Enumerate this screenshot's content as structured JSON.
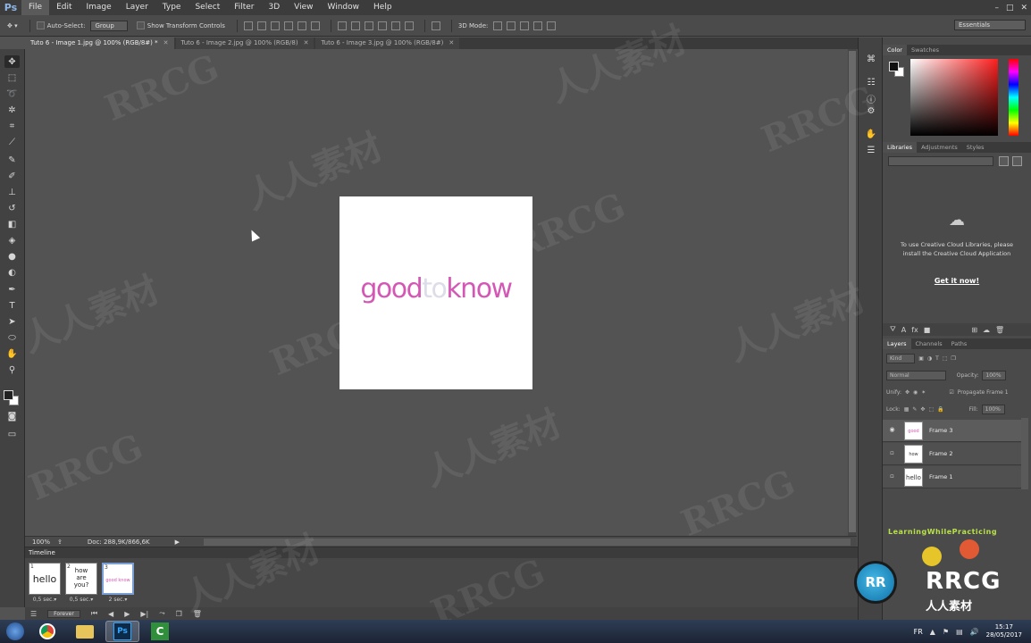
{
  "app": {
    "logo": "Ps",
    "window_controls": [
      "–",
      "□",
      "✕"
    ]
  },
  "menu": [
    "File",
    "Edit",
    "Image",
    "Layer",
    "Type",
    "Select",
    "Filter",
    "3D",
    "View",
    "Window",
    "Help"
  ],
  "options_bar": {
    "auto_select_label": "Auto-Select:",
    "auto_select_value": "Group",
    "show_transform_label": "Show Transform Controls",
    "mode_3d_label": "3D Mode:",
    "workspace": "Essentials"
  },
  "tabs": [
    {
      "label": "Tuto 6 - Image 1.jpg @ 100% (RGB/8#) *",
      "active": true
    },
    {
      "label": "Tuto 6 - Image 2.jpg @ 100% (RGB/8)",
      "active": false
    },
    {
      "label": "Tuto 6 - Image 3.jpg @ 100% (RGB/8#)",
      "active": false
    }
  ],
  "tab_close": "✕",
  "canvas": {
    "logo_left": "good",
    "logo_mid": "to",
    "logo_right": "know",
    "logo_color": "#d457b5"
  },
  "status": {
    "zoom": "100%",
    "doc": "Doc: 288,9K/866,6K"
  },
  "timeline": {
    "title": "Timeline",
    "frames": [
      {
        "num": "1",
        "content": "hello",
        "delay": "0,5 sec.▾"
      },
      {
        "num": "2",
        "content": "how are you?",
        "delay": "0,5 sec.▾"
      },
      {
        "num": "3",
        "content": "good know",
        "delay": "2 sec.▾"
      }
    ],
    "loop": "Forever"
  },
  "panels": {
    "color_tabs": [
      "Color",
      "Swatches"
    ],
    "library_tabs": [
      "Libraries",
      "Adjustments",
      "Styles"
    ],
    "cc_message": "To use Creative Cloud Libraries, please install the Creative Cloud Application",
    "cc_link": "Get it now!",
    "layers_tabs": [
      "Layers",
      "Channels",
      "Paths"
    ],
    "filter_kind": "Kind",
    "blend_mode": "Normal",
    "opacity_label": "Opacity:",
    "opacity_value": "100%",
    "unify_label": "Unify:",
    "propagate_label": "Propagate Frame 1",
    "lock_label": "Lock:",
    "fill_label": "Fill:",
    "fill_value": "100%",
    "layers": [
      {
        "name": "Frame 3",
        "thumb": "good know",
        "visible": true
      },
      {
        "name": "Frame 2",
        "thumb": "how are you",
        "visible": false
      },
      {
        "name": "Frame 1",
        "thumb": "hello",
        "visible": false
      }
    ]
  },
  "overlay": {
    "lwp": "LearningWhilePracticing",
    "brand": "RRCG",
    "brand_cn": "人人素材",
    "logo_initials": "RR",
    "watermark_en": "RRCG",
    "watermark_cn": "人人素材"
  },
  "taskbar": {
    "lang": "FR",
    "time": "15:17",
    "date": "28/05/2017",
    "ps_label": "Ps",
    "camtasia_label": "C"
  },
  "icons": {
    "move": "move-icon",
    "marquee": "marquee-icon",
    "lasso": "lasso-icon",
    "wand": "magic-wand-icon",
    "crop": "crop-icon",
    "eyedropper": "eyedropper-icon",
    "heal": "healing-brush-icon",
    "brush": "brush-icon",
    "stamp": "clone-stamp-icon",
    "history": "history-brush-icon",
    "eraser": "eraser-icon",
    "bucket": "paint-bucket-icon",
    "blur": "blur-icon",
    "dodge": "dodge-icon",
    "pen": "pen-icon",
    "type": "type-icon",
    "path": "path-selection-icon",
    "shape": "ellipse-shape-icon",
    "hand": "hand-icon",
    "zoom": "zoom-icon"
  }
}
